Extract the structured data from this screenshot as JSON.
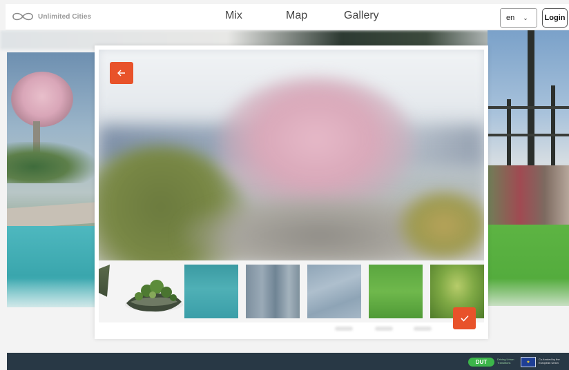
{
  "header": {
    "logo_text": "Unlimited Cities",
    "nav": [
      "Mix",
      "Map",
      "Gallery"
    ],
    "language": {
      "selected": "en"
    },
    "login_label": "Login"
  },
  "modal": {
    "back_icon": "arrow-left-icon",
    "confirm_icon": "checkmark-icon",
    "thumbnails": [
      {
        "name": "vegetation-partial"
      },
      {
        "name": "floating-island"
      },
      {
        "name": "turquoise-water"
      },
      {
        "name": "grey-water"
      },
      {
        "name": "rippled-water"
      },
      {
        "name": "bright-grass"
      },
      {
        "name": "mossy-grass"
      }
    ]
  },
  "footer": {
    "dut_label": "DUT",
    "funding_text": "Co-funded by the European Union"
  },
  "colors": {
    "accent": "#e8522a",
    "footer_bg": "#283845",
    "dut_green": "#3cb54a",
    "eu_blue": "#1f3f95"
  }
}
